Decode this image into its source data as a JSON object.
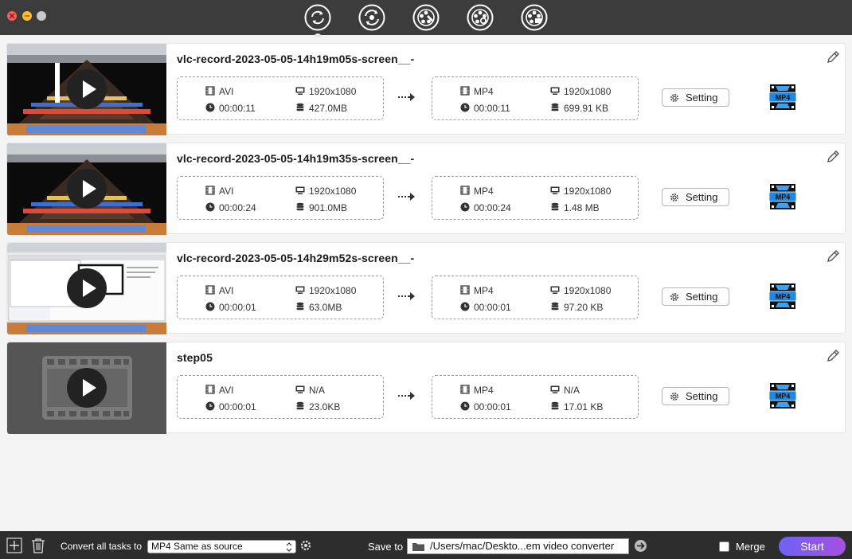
{
  "window": {
    "title": ""
  },
  "toolbar": {
    "tools": [
      {
        "name": "convert-tool",
        "icon": "convert-icon",
        "active": true
      },
      {
        "name": "compress-tool",
        "icon": "compress-icon"
      },
      {
        "name": "edit-tool",
        "icon": "film-reel-edit-icon"
      },
      {
        "name": "effects-tool",
        "icon": "film-reel-settings-icon"
      },
      {
        "name": "media-tool",
        "icon": "film-reel-media-icon"
      }
    ]
  },
  "tasks": [
    {
      "filename": "vlc-record-2023-05-05-14h19m05s-screen__-",
      "thumbnail": "desktop-screen",
      "source": {
        "format": "AVI",
        "resolution": "1920x1080",
        "duration": "00:00:11",
        "size": "427.0MB"
      },
      "output": {
        "format": "MP4",
        "resolution": "1920x1080",
        "duration": "00:00:11",
        "size": "699.91 KB"
      },
      "setting_label": "Setting",
      "format_badge": "MP4"
    },
    {
      "filename": "vlc-record-2023-05-05-14h19m35s-screen__-",
      "thumbnail": "desktop-screen",
      "source": {
        "format": "AVI",
        "resolution": "1920x1080",
        "duration": "00:00:24",
        "size": "901.0MB"
      },
      "output": {
        "format": "MP4",
        "resolution": "1920x1080",
        "duration": "00:00:24",
        "size": "1.48 MB"
      },
      "setting_label": "Setting",
      "format_badge": "MP4"
    },
    {
      "filename": "vlc-record-2023-05-05-14h29m52s-screen__-",
      "thumbnail": "desktop-window",
      "source": {
        "format": "AVI",
        "resolution": "1920x1080",
        "duration": "00:00:01",
        "size": "63.0MB"
      },
      "output": {
        "format": "MP4",
        "resolution": "1920x1080",
        "duration": "00:00:01",
        "size": "97.20 KB"
      },
      "setting_label": "Setting",
      "format_badge": "MP4"
    },
    {
      "filename": "step05",
      "thumbnail": "film-placeholder",
      "source": {
        "format": "AVI",
        "resolution": "N/A",
        "duration": "00:00:01",
        "size": "23.0KB"
      },
      "output": {
        "format": "MP4",
        "resolution": "N/A",
        "duration": "00:00:01",
        "size": "17.01 KB"
      },
      "setting_label": "Setting",
      "format_badge": "MP4"
    }
  ],
  "bottom": {
    "convert_label": "Convert all tasks to",
    "convert_value": "MP4 Same as source",
    "save_label": "Save to",
    "save_path": "/Users/mac/Deskto...em video converter",
    "merge_label": "Merge",
    "merge_checked": false,
    "start_label": "Start"
  },
  "colors": {
    "titlebar": "#3c3c3c",
    "bottombar": "#2d2d2d",
    "start_gradient_from": "#6e63f5",
    "start_gradient_to": "#a54fe0",
    "mp4_badge": "#1e88e5"
  }
}
